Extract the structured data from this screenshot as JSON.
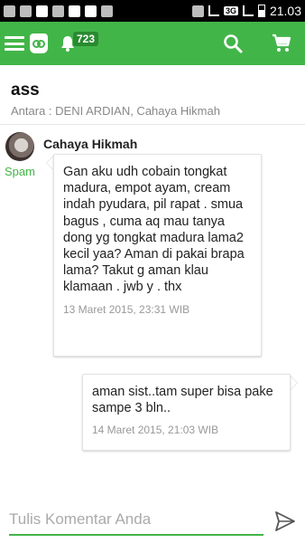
{
  "status_bar": {
    "network": "3G",
    "time": "21.03"
  },
  "app_bar": {
    "notification_count": "723",
    "accent_color": "#42b549",
    "icons": [
      "menu-icon",
      "app-logo-icon",
      "bell-icon",
      "search-icon",
      "cart-icon"
    ]
  },
  "thread": {
    "title": "ass",
    "subtitle": "Antara : DENI ARDIAN, Cahaya Hikmah"
  },
  "messages": [
    {
      "author": "Cahaya Hikmah",
      "spam_label": "Spam",
      "text": "Gan aku udh cobain tongkat madura, empot ayam, cream indah pyudara, pil rapat . smua bagus , cuma aq mau tanya dong yg tongkat madura lama2 kecil yaa? Aman di pakai brapa lama? Takut g aman klau klamaan . jwb y . thx",
      "date": "13 Maret 2015, 23:31 WIB"
    },
    {
      "text": "aman sist..tam super bisa pake sampe 3 bln..",
      "date": "14 Maret 2015, 21:03 WIB"
    }
  ],
  "composer": {
    "placeholder": "Tulis Komentar Anda"
  }
}
